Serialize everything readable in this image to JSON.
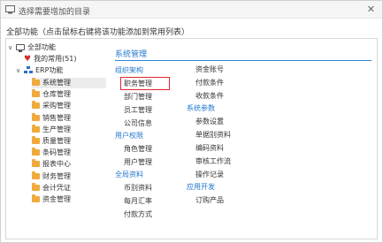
{
  "window": {
    "title": "选择需要增加的目录",
    "close_glyph": "✕"
  },
  "hint": "全部功能（点击鼠标右键将该功能添加到常用列表）",
  "tree": {
    "root": {
      "label": "全部功能",
      "expander": "∨",
      "icon": "monitor-icon"
    },
    "favorites": {
      "label": "我的常用(51)",
      "icon": "heart-icon",
      "icon_glyph": "♥"
    },
    "erp": {
      "label": "ERP功能",
      "expander": "∨",
      "icon": "org-chart-icon"
    },
    "modules": [
      "系统管理",
      "仓库管理",
      "采购管理",
      "销售管理",
      "生产管理",
      "质量管理",
      "条码管理",
      "报表中心",
      "财务管理",
      "会计凭证",
      "资金管理"
    ],
    "selected_index": 0
  },
  "content": {
    "heading": "系统管理",
    "col1": [
      {
        "section": "组织架构",
        "items": [
          "职务管理",
          "部门管理",
          "员工管理",
          "公司信息"
        ]
      },
      {
        "section": "用户权限",
        "items": [
          "角色管理",
          "用户管理"
        ]
      },
      {
        "section": "全局资料",
        "items": [
          "币别资料",
          "每月汇率",
          "付款方式"
        ]
      }
    ],
    "col2_lead": [
      "资金账号",
      "付款条件",
      "收款条件"
    ],
    "col2": [
      {
        "section": "系统参数",
        "items": [
          "参数设置",
          "单据别资料",
          "编码资料",
          "审核工作流",
          "操作记录"
        ]
      },
      {
        "section": "应用开发",
        "items": [
          "订购产品"
        ]
      }
    ],
    "highlighted_item": "职务管理"
  },
  "colors": {
    "accent": "#2277cc",
    "highlight": "#e0282e",
    "folder": "#f0a93b"
  }
}
